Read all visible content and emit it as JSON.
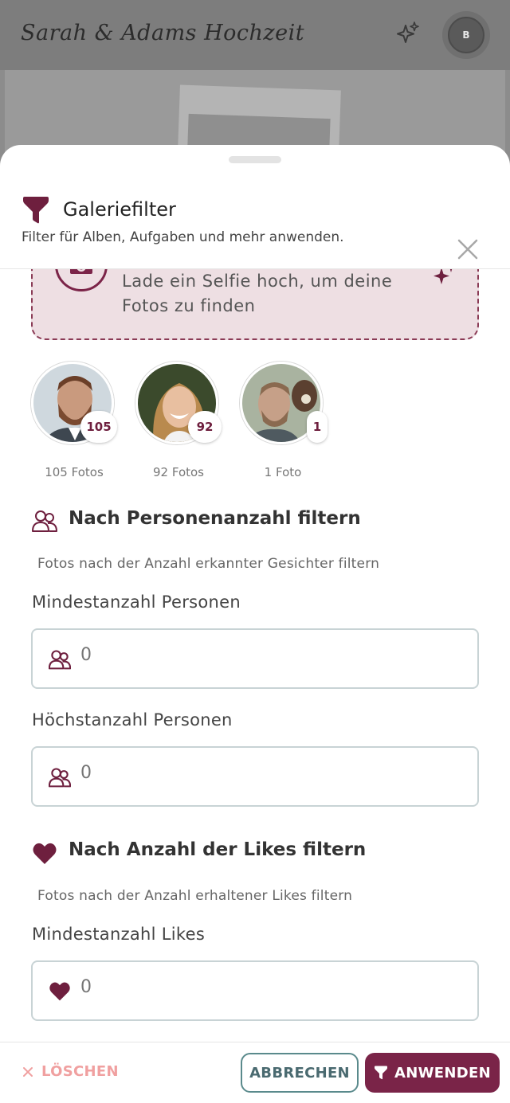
{
  "app": {
    "title": "Sarah & Adams Hochzeit",
    "avatar_initial": "B"
  },
  "sheet": {
    "title": "Galeriefilter",
    "subtitle": "Filter für Alben, Aufgaben und mehr anwenden."
  },
  "selfie": {
    "text": "Lade ein Selfie hoch, um deine Fotos zu finden"
  },
  "people": [
    {
      "count": "105",
      "label": "105 Fotos"
    },
    {
      "count": "92",
      "label": "92 Fotos"
    },
    {
      "count": "1",
      "label": "1 Foto"
    }
  ],
  "person_count_filter": {
    "title": "Nach Personenanzahl filtern",
    "description": "Fotos nach der Anzahl erkannter Gesichter filtern",
    "min_label": "Mindestanzahl Personen",
    "min_placeholder": "0",
    "max_label": "Höchstanzahl Personen",
    "max_placeholder": "0"
  },
  "likes_filter": {
    "title": "Nach Anzahl der Likes filtern",
    "description": "Fotos nach der Anzahl erhaltener Likes filtern",
    "min_label": "Mindestanzahl Likes",
    "min_placeholder": "0"
  },
  "footer": {
    "clear_label": "LÖSCHEN",
    "cancel_label": "ABBRECHEN",
    "apply_label": "ANWENDEN"
  },
  "colors": {
    "brand": "#7a2448",
    "clear": "#f0a0a0",
    "cancel_border": "#5a8a8c",
    "selfie_bg": "#eedfe3"
  }
}
